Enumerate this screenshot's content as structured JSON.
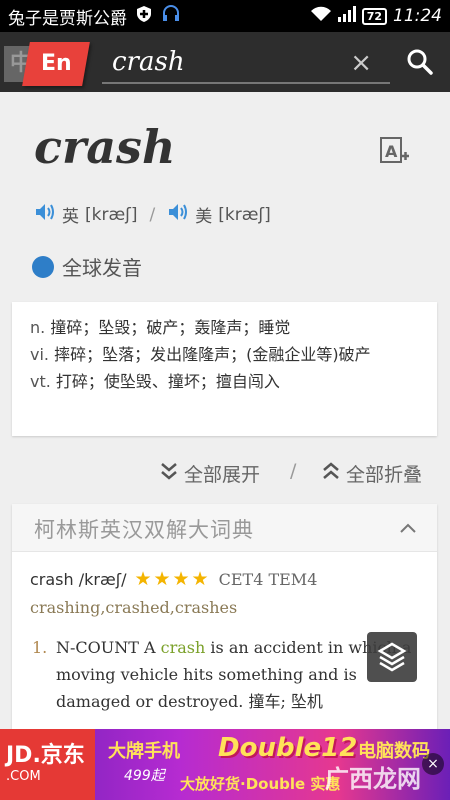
{
  "status_bar": {
    "left_text": "兔子是贾斯公爵",
    "battery": "72",
    "time": "11:24"
  },
  "search": {
    "lang_zh": "中",
    "lang_en": "En",
    "query": "crash",
    "clear_label": "×"
  },
  "word": {
    "headword": "crash",
    "uk_label": "英",
    "uk_phonetic": "[kræʃ]",
    "separator": "/",
    "us_label": "美",
    "us_phonetic": "[kræʃ]",
    "global_pron": "全球发音"
  },
  "definitions": [
    {
      "pos": "n.",
      "text": "撞碎；坠毁；破产；轰隆声；睡觉"
    },
    {
      "pos": "vi.",
      "text": "摔碎；坠落；发出隆隆声；(金融企业等)破产"
    },
    {
      "pos": "vt.",
      "text": "打碎；使坠毁、撞坏；擅自闯入"
    }
  ],
  "controls": {
    "expand_all": "全部展开",
    "slash": "/",
    "collapse_all": "全部折叠"
  },
  "collins": {
    "title": "柯林斯英汉双解大词典",
    "entry_word": "crash /kræʃ/",
    "stars": "★★★★",
    "tags": "CET4 TEM4",
    "forms": "crashing,crashed,crashes",
    "sense_num": "1.",
    "sense_prefix": "N-COUNT A ",
    "sense_keyword": "crash",
    "sense_rest": " is an accident in which a moving vehicle hits something and is damaged or destroyed. 撞车; 坠机"
  },
  "ad": {
    "jd_logo": "JD.京东",
    "jd_sub": ".COM",
    "phone": "大牌手机",
    "phone_sub": "499起",
    "promo": "Double12",
    "promo_sub": "大放好货·Double 实惠",
    "pc": "电脑数码",
    "watermark": "广西龙网",
    "close": "×"
  }
}
